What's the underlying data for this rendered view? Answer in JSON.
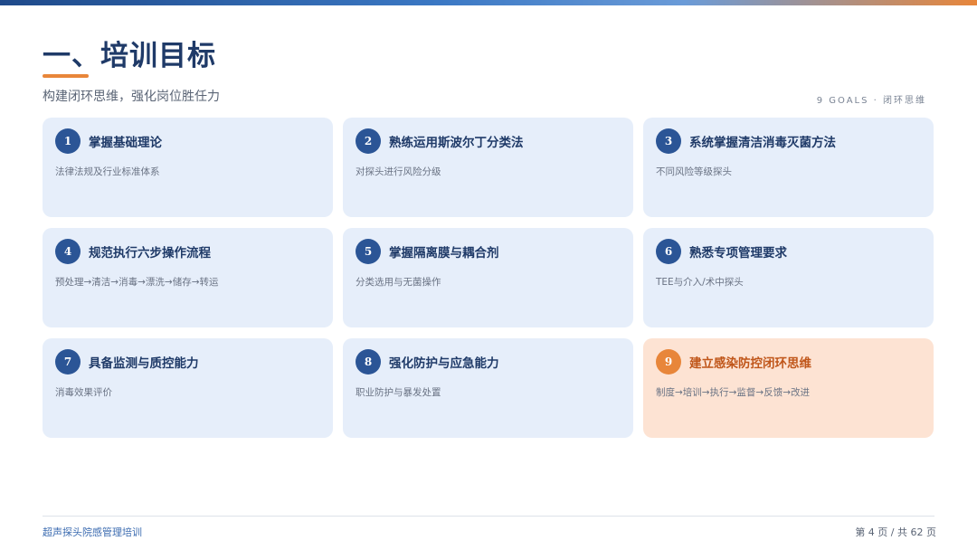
{
  "header": {
    "title": "一、培训目标",
    "subtitle": "构建闭环思维，强化岗位胜任力",
    "goals_tag": "9 GOALS · 闭环思维"
  },
  "goals": [
    {
      "num": "1",
      "title": "掌握基础理论",
      "desc": "法律法规及行业标准体系"
    },
    {
      "num": "2",
      "title": "熟练运用斯波尔丁分类法",
      "desc": "对探头进行风险分级"
    },
    {
      "num": "3",
      "title": "系统掌握清洁消毒灭菌方法",
      "desc": "不同风险等级探头"
    },
    {
      "num": "4",
      "title": "规范执行六步操作流程",
      "desc": "预处理→清洁→消毒→漂洗→储存→转运"
    },
    {
      "num": "5",
      "title": "掌握隔离膜与耦合剂",
      "desc": "分类选用与无菌操作"
    },
    {
      "num": "6",
      "title": "熟悉专项管理要求",
      "desc": "TEE与介入/术中探头"
    },
    {
      "num": "7",
      "title": "具备监测与质控能力",
      "desc": "消毒效果评价"
    },
    {
      "num": "8",
      "title": "强化防护与应急能力",
      "desc": "职业防护与暴发处置"
    },
    {
      "num": "9",
      "title": "建立感染防控闭环思维",
      "desc": "制度→培训→执行→监督→反馈→改进"
    }
  ],
  "footer": {
    "course": "超声探头院感管理培训",
    "page": "第 4 页 / 共 62 页"
  },
  "colors": {
    "primary": "#1f3a68",
    "accent": "#e8863a",
    "card_bg": "#e6eefa",
    "highlight_bg": "#fde3d3"
  }
}
